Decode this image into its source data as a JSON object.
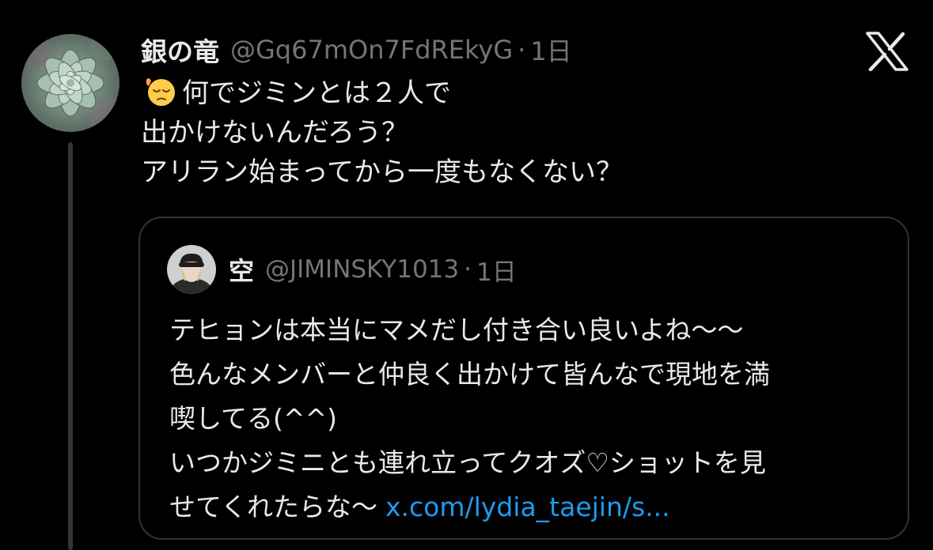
{
  "tweet": {
    "author": {
      "display_name": "銀の竜",
      "handle": "@Gq67mOn7FdREkyG",
      "avatar": "succulent-avatar"
    },
    "separator": "·",
    "time": "1日",
    "emoji": "pensive-face",
    "lines": [
      "何でジミンとは２人で",
      "出かけないんだろう？",
      "アリラン始まってから一度もなくない？"
    ]
  },
  "platform": {
    "logo": "x-logo"
  },
  "quote": {
    "author": {
      "display_name": "空",
      "handle": "@JIMINSKY1013",
      "avatar": "person-avatar"
    },
    "separator": "·",
    "time": "1日",
    "lines": [
      "テヒョンは本当にマメだし付き合い良いよね〜〜",
      "色んなメンバーと仲良く出かけて皆んなで現地を満",
      "喫してる(^^)",
      "いつかジミニとも連れ立ってクオズ♡ショットを見"
    ],
    "last_line": "せてくれたらな〜",
    "link_text": "x.com/lydia_taejin/s..."
  },
  "colors": {
    "background": "#000000",
    "text": "#e7e9ea",
    "secondary": "#71767b",
    "link": "#1d9bf0",
    "border": "#2f3336"
  }
}
